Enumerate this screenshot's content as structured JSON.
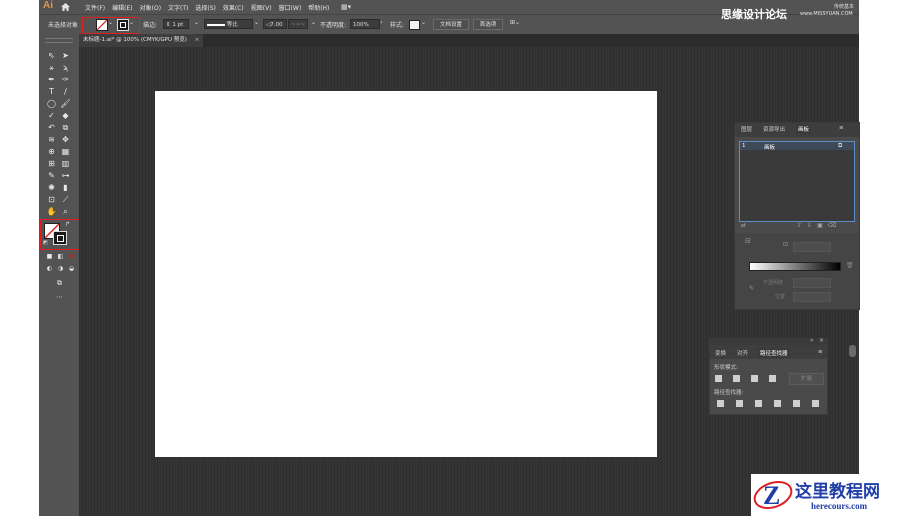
{
  "app": {
    "logo": "Ai",
    "menus": [
      "文件(F)",
      "编辑(E)",
      "对象(O)",
      "文字(T)",
      "选择(S)",
      "效果(C)",
      "视图(V)",
      "窗口(W)",
      "帮助(H)"
    ],
    "workspace_icon": "grid-icon",
    "workspace_label": "传统基本"
  },
  "control_bar": {
    "selection_label": "未选择对象",
    "stroke_label": "描边:",
    "stroke_weight": "1 pt",
    "stroke_style": "等比",
    "brush_size": "7.00",
    "opacity_label": "不透明度:",
    "opacity_value": "100%",
    "style_label": "样式:",
    "doc_setup_button": "文档设置",
    "prefs_button": "首选项"
  },
  "document": {
    "tab_title": "未标题-1.ai* @ 100% (CMYK/GPU 预览)",
    "close": "×"
  },
  "layers_panel": {
    "tabs": [
      "图层",
      "资源导出",
      "画板"
    ],
    "artboard_number": "1",
    "artboard_name": "画板"
  },
  "gradient_panel": {
    "opacity_label": "不透明度",
    "position_label": "位置"
  },
  "pathfinder_panel": {
    "tabs": [
      "变换",
      "对齐",
      "路径查找器"
    ],
    "shape_modes_label": "形状模式:",
    "expand_button": "扩展",
    "pathfinders_label": "路径查找器:"
  },
  "watermark": {
    "top_text": "思缘设计论坛",
    "top_url": "www.MISSYUAN.COM",
    "brand_cn": "这里教程网",
    "brand_url": "herecours.com"
  },
  "colors": {
    "accent_red": "#e02020",
    "ai_orange": "#e2954a",
    "brand_blue": "#1f3ea8"
  }
}
